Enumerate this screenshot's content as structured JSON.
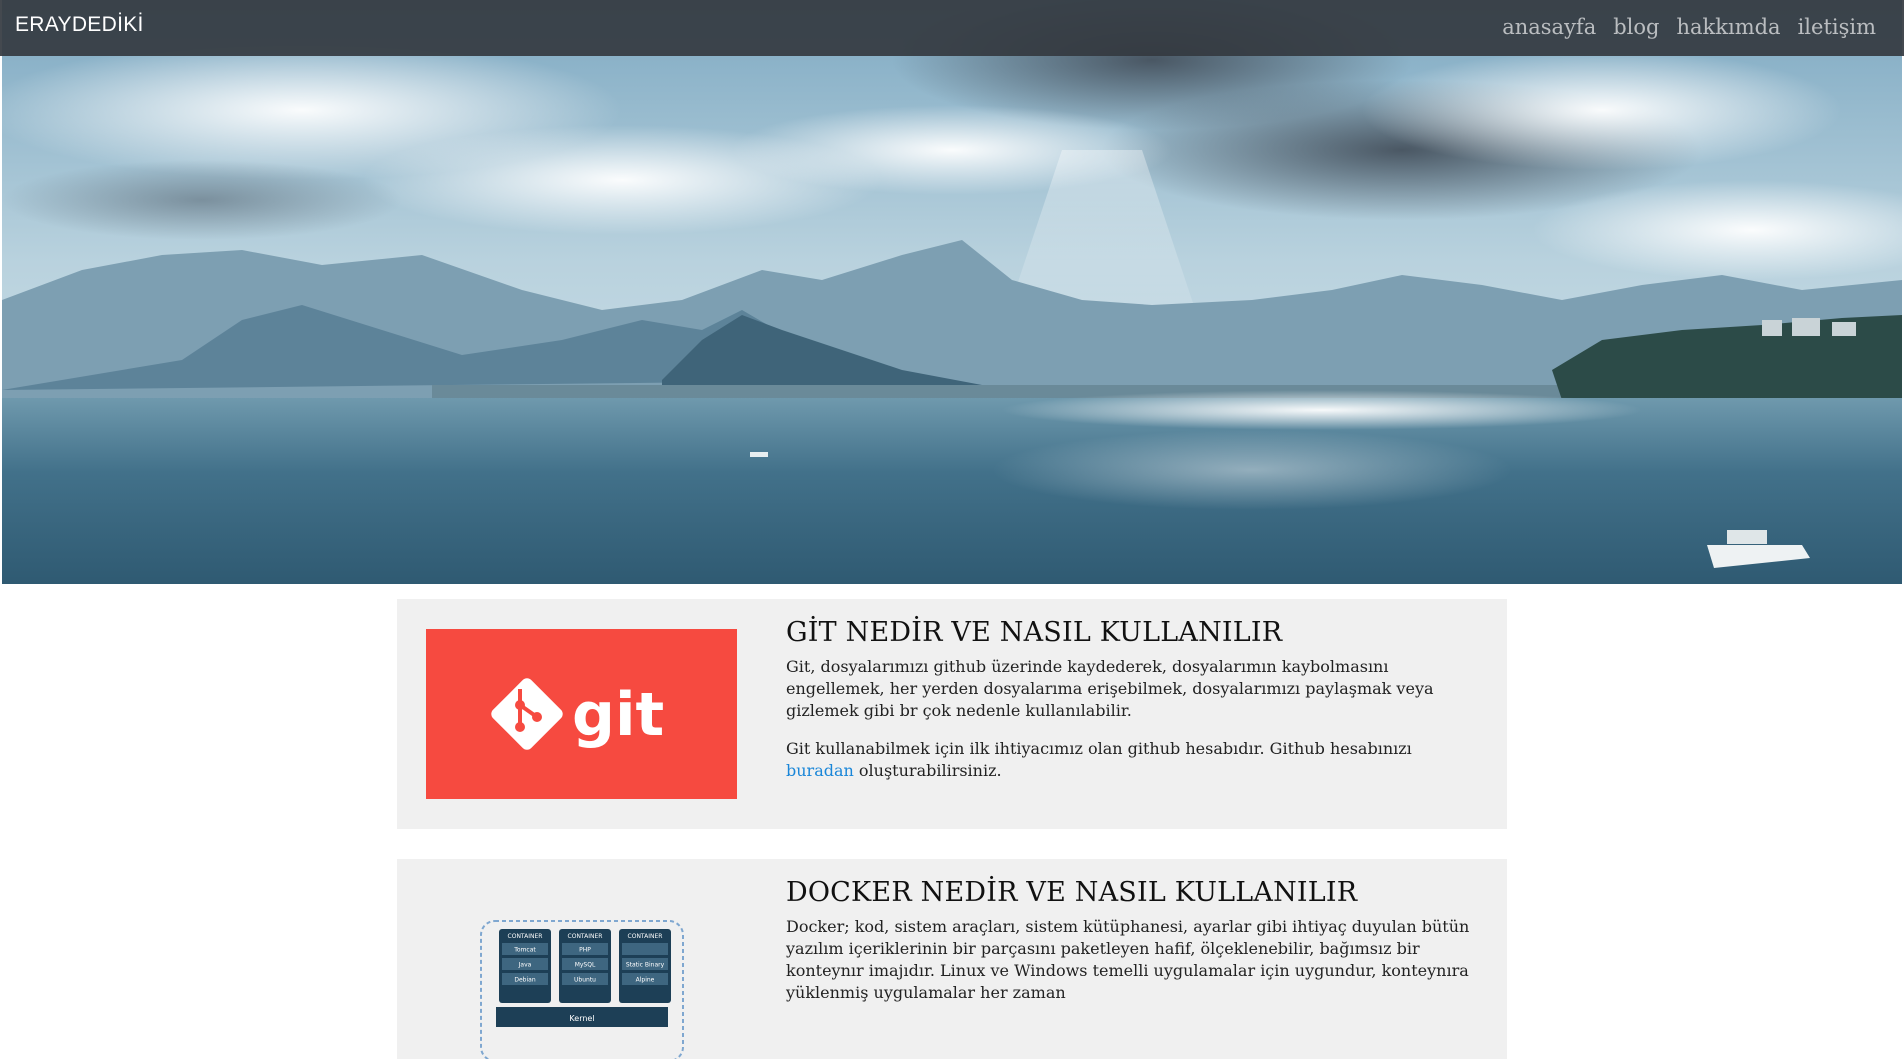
{
  "navbar": {
    "brand": "ERAYDEDİKİ",
    "links": [
      "anasayfa",
      "blog",
      "hakkımda",
      "iletişim"
    ]
  },
  "posts": [
    {
      "title": "GİT NEDİR VE NASIL KULLANILIR",
      "paragraph1": "Git, dosyalarımızı github üzerinde kaydederek, dosyalarımın kaybolmasını engellemek, her yerden dosyalarıma erişebilmek, dosyalarımızı paylaşmak veya gizlemek gibi br çok nedenle kullanılabilir.",
      "paragraph2_before": "Git kullanabilmek için ilk ihtiyacımız olan github hesabıdır. Github hesabınızı ",
      "paragraph2_link": "buradan",
      "paragraph2_after": " oluşturabilirsiniz.",
      "thumb_logo_text": "git"
    },
    {
      "title": "DOCKER NEDİR VE NASIL KULLANILIR",
      "paragraph1": "Docker; kod, sistem araçları, sistem kütüphanesi, ayarlar gibi ihtiyaç duyulan bütün yazılım içeriklerinin bir parçasını paketleyen hafif, ölçeklenebilir, bağımsız bir konteynır imajıdır. Linux ve Windows temelli uygulamalar için uygundur, konteynıra yüklenmiş uygulamalar her zaman",
      "diagram": {
        "containers": [
          {
            "header": "CONTAINER",
            "rows": [
              "Tomcat",
              "Java",
              "Debian"
            ]
          },
          {
            "header": "CONTAINER",
            "rows": [
              "PHP",
              "MySQL",
              "Ubuntu"
            ]
          },
          {
            "header": "CONTAINER",
            "rows": [
              "",
              "Static Binary",
              "Alpine"
            ]
          }
        ],
        "kernel": "Kernel"
      }
    }
  ],
  "colors": {
    "navbar_bg": "#343a40",
    "git_red": "#f64a40",
    "link_blue": "#1a86d8",
    "card_bg": "#f0f0f0",
    "docker_navy": "#1d3f56"
  }
}
